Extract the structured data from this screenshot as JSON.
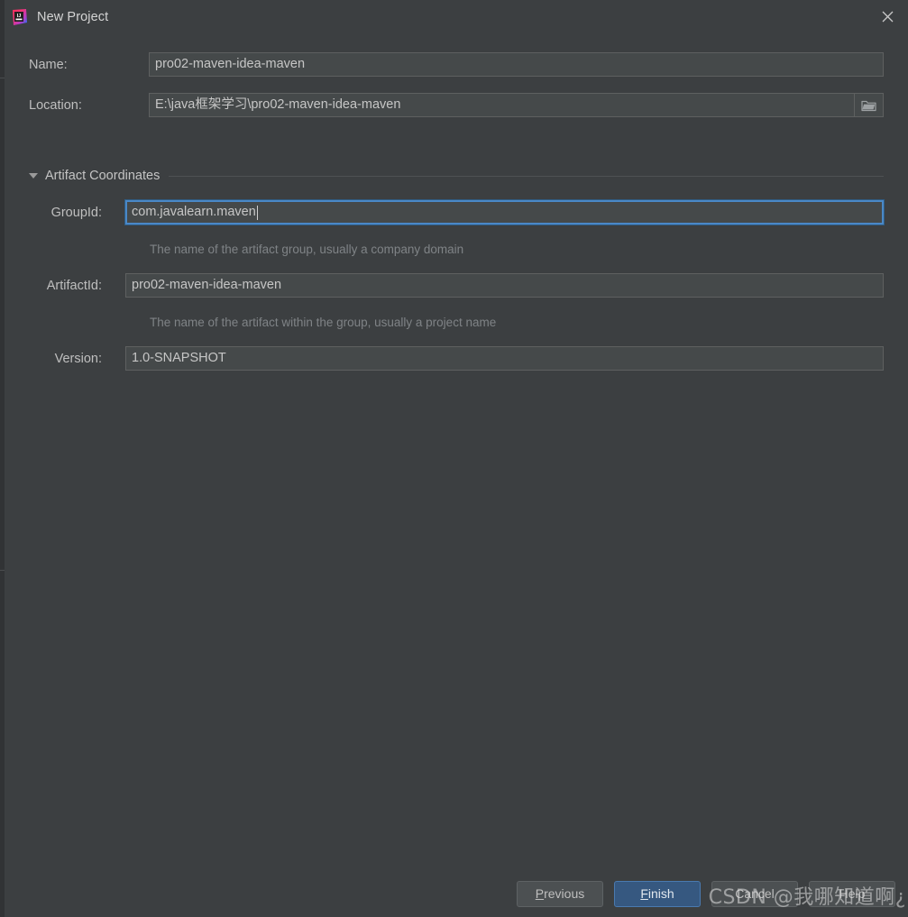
{
  "window": {
    "title": "New Project",
    "app_icon": "intellij-idea-icon",
    "close_icon": "close-icon"
  },
  "form": {
    "name": {
      "label": "Name:",
      "value": "pro02-maven-idea-maven",
      "placeholder": ""
    },
    "location": {
      "label": "Location:",
      "value": "E:\\java框架学习\\pro02-maven-idea-maven",
      "placeholder": "",
      "browse_icon": "folder-icon"
    }
  },
  "section": {
    "title": "Artifact Coordinates",
    "expanded": true,
    "arrow_icon": "chevron-down-icon",
    "fields": {
      "groupid": {
        "label": "GroupId:",
        "value": "com.javalearn.maven",
        "hint": "The name of the artifact group, usually a company domain",
        "focused": true
      },
      "artifactid": {
        "label": "ArtifactId:",
        "value": "pro02-maven-idea-maven",
        "hint": "The name of the artifact within the group, usually a project name",
        "focused": false
      },
      "version": {
        "label": "Version:",
        "value": "1.0-SNAPSHOT",
        "hint": "",
        "focused": false
      }
    }
  },
  "footer": {
    "previous": {
      "label": "Previous",
      "mnemonic": "P"
    },
    "finish": {
      "label": "Finish",
      "mnemonic": "F"
    },
    "cancel": {
      "label": "Cancel"
    },
    "help": {
      "label": "Help"
    }
  },
  "watermark": {
    "text": "CSDN @我哪知道啊¿"
  },
  "colors": {
    "dialog_background": "#3c3f41",
    "input_background": "#45494a",
    "focus_border": "#4a88c7",
    "primary_button": "#365880",
    "text": "#bfbfbf",
    "hint_text": "#7f8386"
  }
}
